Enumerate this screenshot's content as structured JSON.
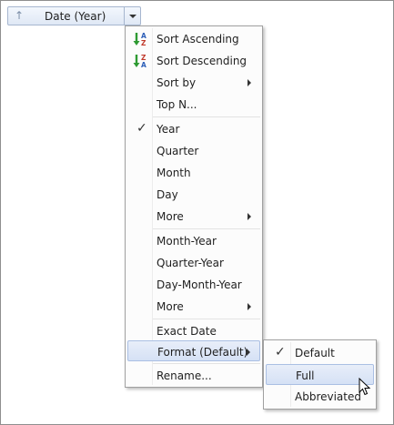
{
  "field": {
    "label": "Date (Year)"
  },
  "menu": {
    "sort_ascending": "Sort Ascending",
    "sort_descending": "Sort Descending",
    "sort_by": "Sort by",
    "top_n": "Top N...",
    "year": "Year",
    "quarter": "Quarter",
    "month": "Month",
    "day": "Day",
    "more_1": "More",
    "month_year": "Month-Year",
    "quarter_year": "Quarter-Year",
    "day_month_year": "Day-Month-Year",
    "more_2": "More",
    "exact_date": "Exact Date",
    "format": "Format (Default)",
    "rename": "Rename..."
  },
  "submenu": {
    "default": "Default",
    "full": "Full",
    "abbreviated": "Abbreviated"
  },
  "sort_icon_letters": {
    "a": "A",
    "z": "Z"
  },
  "colors": {
    "highlight": "#d5e1f5",
    "sort_arrow_green": "#2e9a32",
    "sort_letter_blue": "#2d5fb8",
    "sort_letter_red": "#c0392b"
  }
}
